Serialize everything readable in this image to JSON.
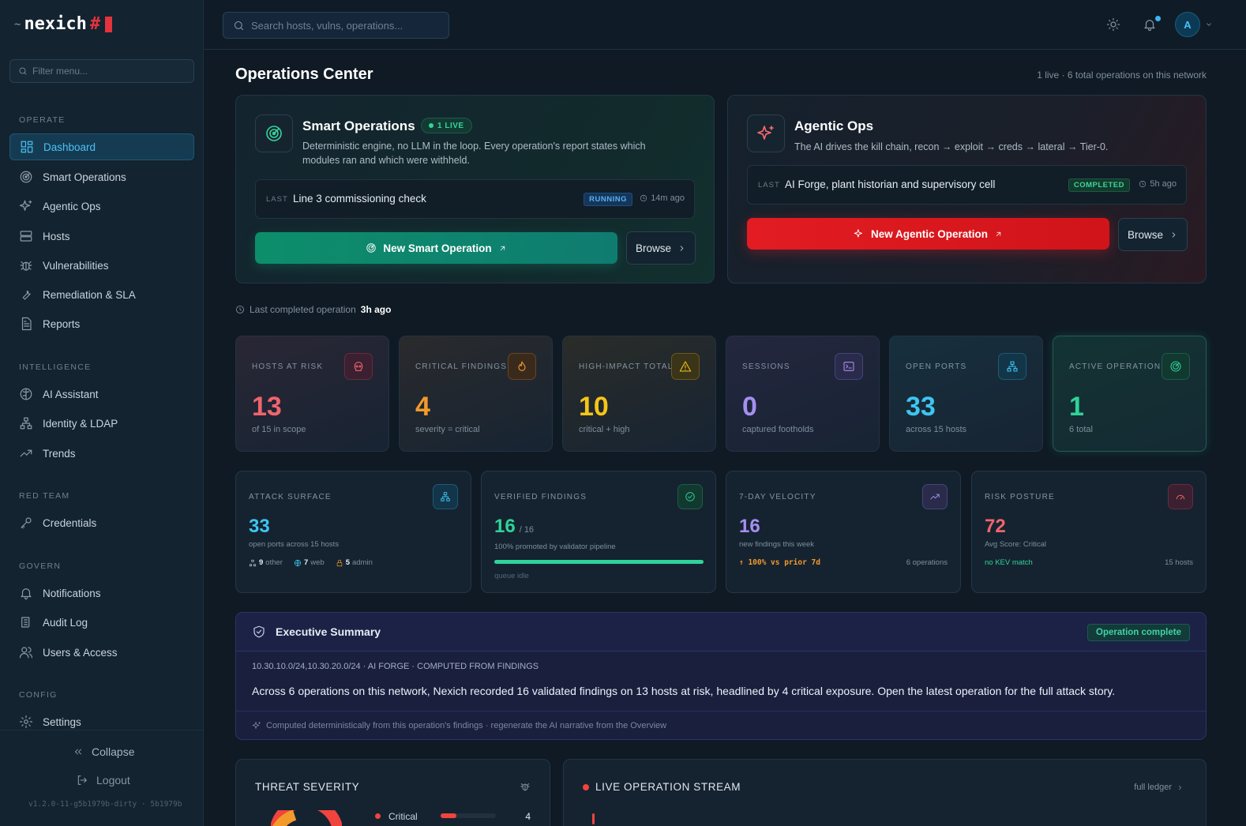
{
  "brand": {
    "name": "nexich",
    "symbol": "#"
  },
  "sidebar": {
    "filter_placeholder": "Filter menu...",
    "sections": {
      "operate": "OPERATE",
      "intelligence": "INTELLIGENCE",
      "red_team": "RED TEAM",
      "govern": "GOVERN",
      "config": "CONFIG"
    },
    "items": {
      "dashboard": "Dashboard",
      "smart_operations": "Smart Operations",
      "agentic_ops": "Agentic Ops",
      "hosts": "Hosts",
      "vulnerabilities": "Vulnerabilities",
      "remediation": "Remediation & SLA",
      "reports": "Reports",
      "ai_assistant": "AI Assistant",
      "identity": "Identity & LDAP",
      "trends": "Trends",
      "credentials": "Credentials",
      "notifications": "Notifications",
      "audit_log": "Audit Log",
      "users_access": "Users & Access",
      "settings": "Settings"
    },
    "collapse": "Collapse",
    "logout": "Logout",
    "version": "v1.2.0-11-g5b1979b-dirty · 5b1979b"
  },
  "topbar": {
    "search_placeholder": "Search hosts, vulns, operations...",
    "avatar_initial": "A"
  },
  "page": {
    "title": "Operations Center",
    "subtitle": "1 live · 6 total operations on this network"
  },
  "smart_ops": {
    "title": "Smart Operations",
    "live_badge": "1 LIVE",
    "description": "Deterministic engine, no LLM in the loop. Every operation's report states which modules ran and which were withheld.",
    "last_label": "LAST",
    "last_name": "Line 3 commissioning check",
    "last_status": "RUNNING",
    "last_ago": "14m ago",
    "primary_button": "New Smart Operation",
    "browse_button": "Browse"
  },
  "agentic_ops": {
    "title": "Agentic Ops",
    "description": "The AI drives the kill chain, recon → exploit → creds → lateral → Tier-0.",
    "last_label": "LAST",
    "last_name": "AI Forge, plant historian and supervisory cell",
    "last_status": "COMPLETED",
    "last_ago": "5h ago",
    "primary_button": "New Agentic Operation",
    "browse_button": "Browse"
  },
  "last_completed": {
    "label": "Last completed operation",
    "value": "3h ago"
  },
  "stats": [
    {
      "label": "HOSTS AT RISK",
      "value": "13",
      "sub": "of 15 in scope",
      "color": "#f0646d",
      "icon": "skull-icon"
    },
    {
      "label": "CRITICAL FINDINGS",
      "value": "4",
      "sub": "severity = critical",
      "color": "#f39a2c",
      "icon": "flame-icon"
    },
    {
      "label": "HIGH-IMPACT TOTAL",
      "value": "10",
      "sub": "critical + high",
      "color": "#f5c518",
      "icon": "warning-icon"
    },
    {
      "label": "SESSIONS",
      "value": "0",
      "sub": "captured footholds",
      "color": "#a58ff0",
      "icon": "terminal-icon"
    },
    {
      "label": "OPEN PORTS",
      "value": "33",
      "sub": "across 15 hosts",
      "color": "#3ec5f0",
      "icon": "network-icon"
    },
    {
      "label": "ACTIVE OPERATIONS",
      "value": "1",
      "sub": "6 total",
      "color": "#2fd39a",
      "icon": "radar-icon"
    }
  ],
  "metrics": {
    "attack_surface": {
      "label": "ATTACK SURFACE",
      "value": "33",
      "sub": "open ports across 15 hosts",
      "other": "9",
      "other_label": "other",
      "web": "7",
      "web_label": "web",
      "admin": "5",
      "admin_label": "admin"
    },
    "verified": {
      "label": "VERIFIED FINDINGS",
      "value": "16",
      "total": "/ 16",
      "sub": "100% promoted by validator pipeline",
      "progress": 1.0,
      "queue": "queue idle"
    },
    "velocity": {
      "label": "7-DAY VELOCITY",
      "value": "16",
      "sub": "new findings this week",
      "trend": "↑ 100% vs prior 7d",
      "ops": "6 operations"
    },
    "risk": {
      "label": "RISK POSTURE",
      "value": "72",
      "sub": "Avg Score: Critical",
      "kev": "no KEV match",
      "hosts": "15 hosts"
    }
  },
  "executive_summary": {
    "title": "Executive Summary",
    "badge": "Operation complete",
    "meta": "10.30.10.0/24,10.30.20.0/24 · AI FORGE · COMPUTED FROM FINDINGS",
    "text": "Across 6 operations on this network, Nexich recorded 16 validated findings on 13 hosts at risk, headlined by 4 critical exposure. Open the latest operation for the full attack story.",
    "footer": "Computed deterministically from this operation's findings · regenerate the AI narrative from the Overview"
  },
  "threat_severity": {
    "title": "THREAT SEVERITY",
    "first_label": "Critical",
    "first_value": "4"
  },
  "live_stream": {
    "title": "LIVE OPERATION STREAM",
    "link": "full ledger"
  },
  "colors": {
    "accent": "#4cc0f5",
    "green": "#2fd39a",
    "red": "#e21c22"
  }
}
